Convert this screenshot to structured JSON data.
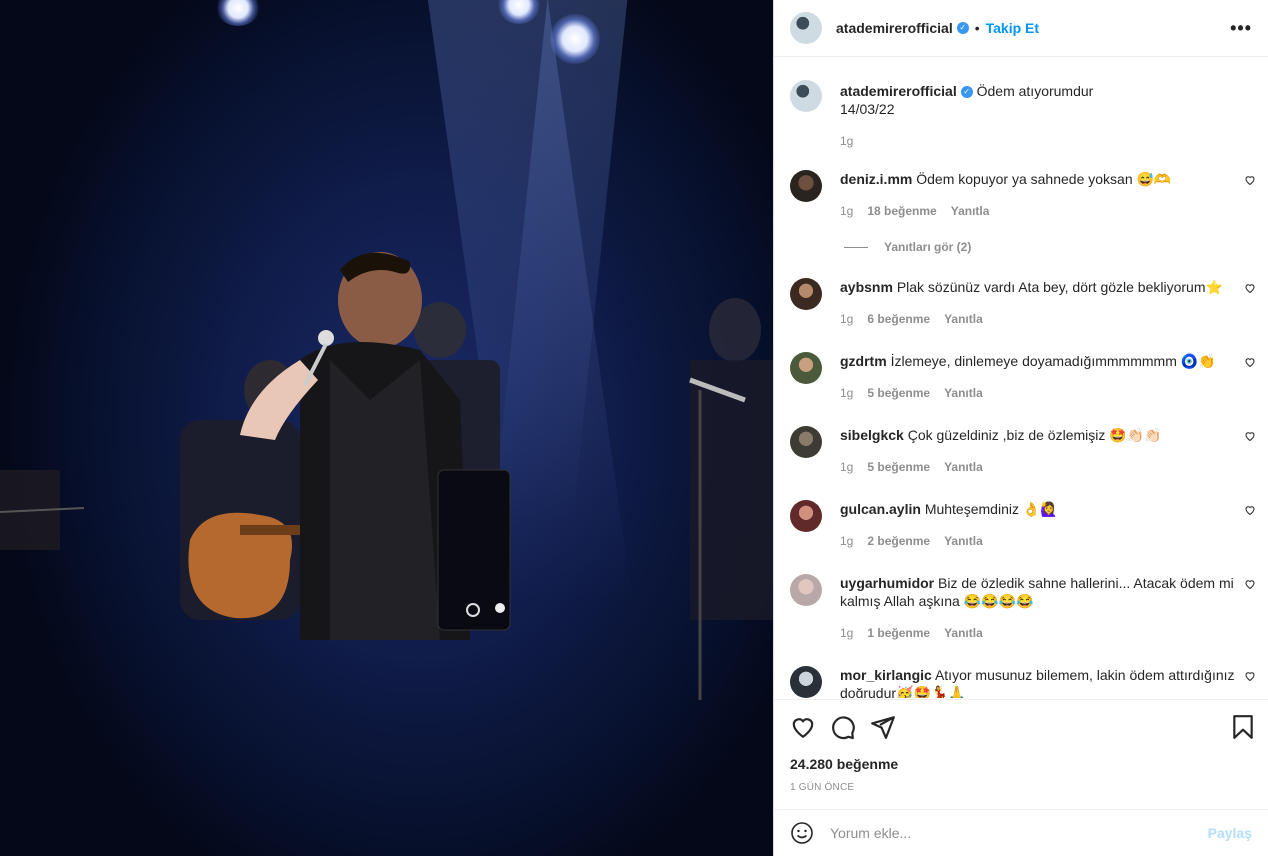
{
  "header": {
    "username": "atademirerofficial",
    "separator": "•",
    "follow_label": "Takip Et",
    "more_label": "•••"
  },
  "caption": {
    "username": "atademirerofficial",
    "text": "Ödem atıyorumdur",
    "line2": "14/03/22",
    "time": "1g"
  },
  "comments": [
    {
      "user": "deniz.i.mm",
      "text": "Ödem kopuyor ya sahnede yoksan 😅🫶",
      "time": "1g",
      "likes": "18 beğenme",
      "reply": "Yanıtla"
    },
    {
      "user": "aybsnm",
      "text": "Plak sözünüz vardı Ata bey, dört gözle bekliyorum⭐",
      "time": "1g",
      "likes": "6 beğenme",
      "reply": "Yanıtla"
    },
    {
      "user": "gzdrtm",
      "text": "İzlemeye, dinlemeye doyamadığımmmmmmm 🧿👏",
      "time": "1g",
      "likes": "5 beğenme",
      "reply": "Yanıtla"
    },
    {
      "user": "sibelgkck",
      "text": "Çok güzeldiniz ,biz de özlemişiz 🤩👏🏻👏🏻",
      "time": "1g",
      "likes": "5 beğenme",
      "reply": "Yanıtla"
    },
    {
      "user": "gulcan.aylin",
      "text": "Muhteşemdiniz 👌🙋‍♀️",
      "time": "1g",
      "likes": "2 beğenme",
      "reply": "Yanıtla"
    },
    {
      "user": "uygarhumidor",
      "text": "Biz de özledik sahne hallerini... Atacak ödem mi kalmış Allah aşkına 😂😂😂😂",
      "time": "1g",
      "likes": "1 beğenme",
      "reply": "Yanıtla"
    },
    {
      "user": "mor_kirlangic",
      "text": "Atıyor musunuz bilemem, lakin ödem attırdığınız doğrudur🥳🤩💃🙏",
      "time": "",
      "likes": "",
      "reply": ""
    }
  ],
  "replies_toggle": "Yanıtları gör (2)",
  "likes_count": "24.280 beğenme",
  "time_ago": "1 GÜN ÖNCE",
  "add_comment": {
    "placeholder": "Yorum ekle...",
    "share_label": "Paylaş"
  },
  "colors": {
    "accent": "#0095f6",
    "verified": "#3897f0"
  }
}
